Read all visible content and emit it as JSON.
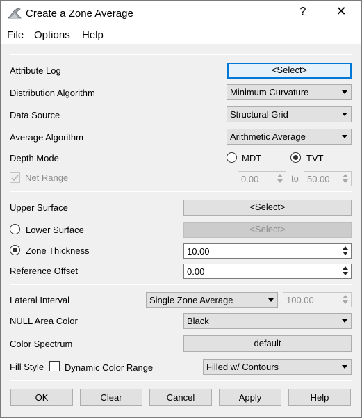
{
  "window": {
    "title": "Create a Zone Average",
    "help_glyph": "?",
    "close_glyph": "✕"
  },
  "menu": [
    "File",
    "Options",
    "Help"
  ],
  "attribute_log": {
    "label": "Attribute Log",
    "button": "<Select>"
  },
  "distribution_algorithm": {
    "label": "Distribution Algorithm",
    "value": "Minimum Curvature"
  },
  "data_source": {
    "label": "Data Source",
    "value": "Structural Grid"
  },
  "average_algorithm": {
    "label": "Average Algorithm",
    "value": "Arithmetic Average"
  },
  "depth_mode": {
    "label": "Depth Mode",
    "options": [
      "MDT",
      "TVT"
    ],
    "selected": "TVT"
  },
  "net_range": {
    "label": "Net Range",
    "checked": true,
    "enabled": false,
    "from": "0.00",
    "to_label": "to",
    "to": "50.00"
  },
  "upper_surface": {
    "label": "Upper Surface",
    "button": "<Select>"
  },
  "lower_surface": {
    "label": "Lower Surface",
    "button": "<Select>",
    "selected": false
  },
  "zone_thickness": {
    "label": "Zone Thickness",
    "value": "10.00",
    "selected": true
  },
  "reference_offset": {
    "label": "Reference Offset",
    "value": "0.00"
  },
  "lateral_interval": {
    "label": "Lateral Interval",
    "value": "Single Zone Average",
    "spin_value": "100.00"
  },
  "null_area_color": {
    "label": "NULL Area Color",
    "value": "Black"
  },
  "color_spectrum": {
    "label": "Color Spectrum",
    "button": "default"
  },
  "fill_style": {
    "label": "Fill Style",
    "checkbox_label": "Dynamic Color Range",
    "checked": false,
    "value": "Filled w/ Contours"
  },
  "buttons": {
    "ok": "OK",
    "clear": "Clear",
    "cancel": "Cancel",
    "apply": "Apply",
    "help": "Help"
  },
  "colors": {
    "focus_border": "#0078d7",
    "button_bg": "#e1e1e1",
    "dialog_bg": "#f0f0f0"
  }
}
